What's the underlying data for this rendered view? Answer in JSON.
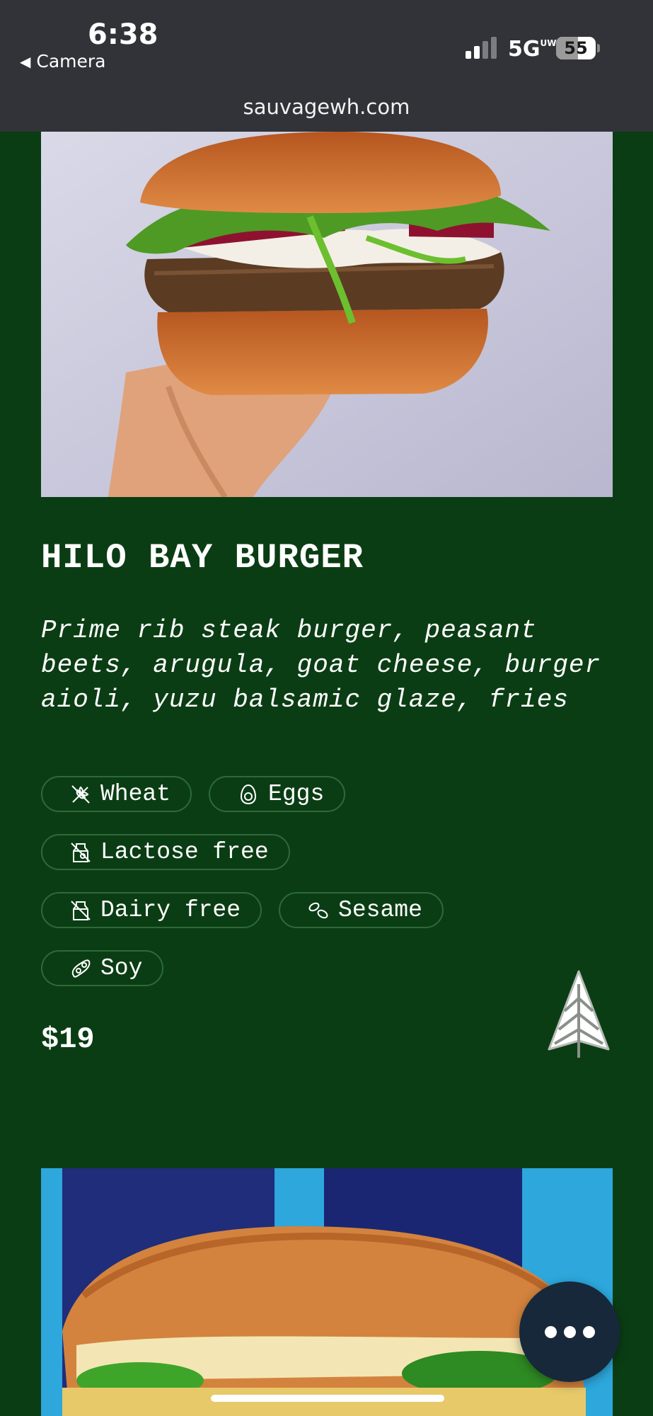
{
  "status_bar": {
    "time": "6:38",
    "back_label": "Camera",
    "network": "5G",
    "network_sub": "UW",
    "battery": "55",
    "battery_level": 0.55
  },
  "browser": {
    "url": "sauvagewh.com"
  },
  "menu_item": {
    "name": "HILO BAY BURGER",
    "description": "Prime rib steak burger, peasant beets, arugula, goat cheese, burger aioli, yuzu balsamic glaze, fries",
    "price": "$19",
    "allergens": [
      {
        "label": "Wheat",
        "icon": "wheat-icon"
      },
      {
        "label": "Eggs",
        "icon": "egg-icon"
      },
      {
        "label": "Lactose free",
        "icon": "lactose-free-icon"
      },
      {
        "label": "Dairy free",
        "icon": "dairy-free-icon"
      },
      {
        "label": "Sesame",
        "icon": "sesame-icon"
      },
      {
        "label": "Soy",
        "icon": "soy-icon"
      }
    ]
  },
  "colors": {
    "page_background": "#0b3d14",
    "tag_border": "#2e6a38",
    "status_bar": "#313338",
    "fab": "#17283b"
  }
}
